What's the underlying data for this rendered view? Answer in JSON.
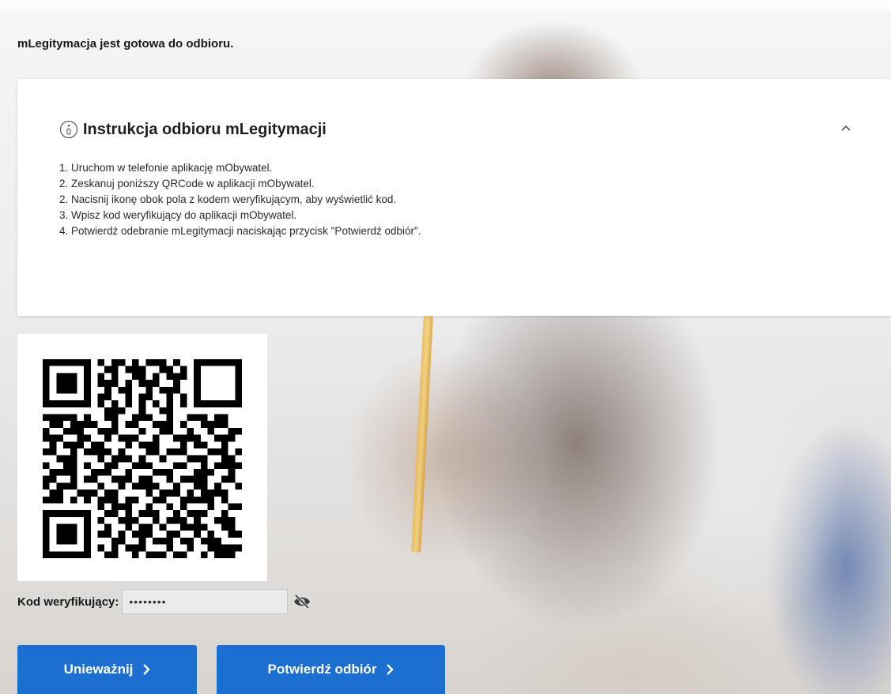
{
  "status": {
    "ready_text": "mLegitymacja jest gotowa do odbioru."
  },
  "instructions": {
    "title": "Instrukcja odbioru mLegitymacji",
    "info_icon": "info-circle-icon",
    "collapse_icon": "chevron-up-icon",
    "steps": [
      "1. Uruchom w telefonie aplikację mObywatel.",
      "2. Zeskanuj poniższy QRCode w aplikacji mObywatel.",
      "2. Nacisnij ikonę obok pola z kodem weryfikującym, aby wyświetlić kod.",
      "3. Wpisz kod weryfikujący do aplikacji mObywatel.",
      "4. Potwierdź odebranie mLegitymacji naciskając przycisk \"Potwierdź odbiór\"."
    ]
  },
  "verification": {
    "label": "Kod weryfikujący:",
    "masked_value": "••••••••",
    "toggle_icon": "eye-slash-icon"
  },
  "actions": {
    "cancel_label": "Unieważnij",
    "confirm_label": "Potwierdź odbiór",
    "chevron": "›"
  },
  "colors": {
    "primary_button": "#1b6fd1",
    "panel_background": "#ffffff"
  }
}
